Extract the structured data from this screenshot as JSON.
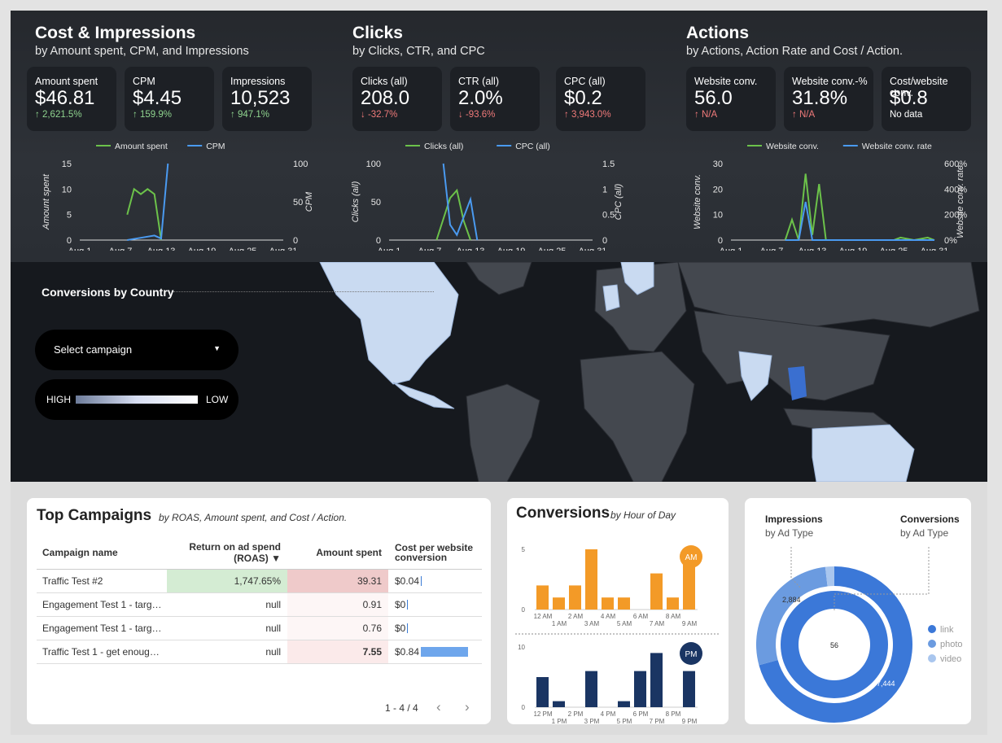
{
  "sections": [
    {
      "title": "Cost & Impressions",
      "subtitle": "by Amount spent, CPM, and Impressions",
      "cards": [
        {
          "label": "Amount spent",
          "value": "$46.81",
          "change": "2,621.5%",
          "dir": "up"
        },
        {
          "label": "CPM",
          "value": "$4.45",
          "change": "159.9%",
          "dir": "up"
        },
        {
          "label": "Impressions",
          "value": "10,523",
          "change": "947.1%",
          "dir": "up"
        }
      ]
    },
    {
      "title": "Clicks",
      "subtitle": "by Clicks, CTR, and CPC",
      "cards": [
        {
          "label": "Clicks (all)",
          "value": "208.0",
          "change": "-32.7%",
          "dir": "dn"
        },
        {
          "label": "CTR (all)",
          "value": "2.0%",
          "change": "-93.6%",
          "dir": "dn"
        },
        {
          "label": "CPC (all)",
          "value": "$0.2",
          "change": "3,943.0%",
          "dir": "dn"
        }
      ]
    },
    {
      "title": "Actions",
      "subtitle": "by Actions, Action Rate and Cost / Action.",
      "cards": [
        {
          "label": "Website conv.",
          "value": "56.0",
          "change": "N/A",
          "dir": "dn"
        },
        {
          "label": "Website conv.-%",
          "value": "31.8%",
          "change": "N/A",
          "dir": "dn"
        },
        {
          "label": "Cost/website conv.",
          "value": "$0.8",
          "change": "No data",
          "dir": "nd"
        }
      ]
    }
  ],
  "up_arrow": "↑",
  "down_arrow": "↓",
  "chart_data": [
    {
      "type": "line",
      "x": [
        "Aug 1",
        "Aug 7",
        "Aug 13",
        "Aug 19",
        "Aug 25",
        "Aug 31"
      ],
      "series": [
        {
          "name": "Amount spent",
          "axis": "left",
          "color": "#6cc24a",
          "points": [
            [
              8,
              5
            ],
            [
              9,
              10
            ],
            [
              10,
              9
            ],
            [
              11,
              10
            ],
            [
              12,
              9
            ],
            [
              13,
              0
            ]
          ]
        },
        {
          "name": "CPM",
          "axis": "right",
          "color": "#4a9af0",
          "points": [
            [
              8,
              0
            ],
            [
              10,
              3
            ],
            [
              12,
              6
            ],
            [
              13,
              2
            ],
            [
              14,
              100
            ]
          ]
        }
      ],
      "yleft": {
        "label": "Amount spent",
        "ticks": [
          "0",
          "5",
          "10",
          "15"
        ],
        "max": 15
      },
      "yright": {
        "label": "CPM",
        "ticks": [
          "0",
          "50",
          "100"
        ],
        "max": 100
      }
    },
    {
      "type": "line",
      "x": [
        "Aug 1",
        "Aug 7",
        "Aug 13",
        "Aug 19",
        "Aug 25",
        "Aug 31"
      ],
      "series": [
        {
          "name": "Clicks (all)",
          "axis": "left",
          "color": "#6cc24a",
          "points": [
            [
              8,
              0
            ],
            [
              10,
              55
            ],
            [
              11,
              65
            ],
            [
              12,
              25
            ],
            [
              13,
              0
            ]
          ]
        },
        {
          "name": "CPC (all)",
          "axis": "right",
          "color": "#4a9af0",
          "points": [
            [
              9,
              1.5
            ],
            [
              10,
              0.3
            ],
            [
              11,
              0.1
            ],
            [
              13,
              0.8
            ],
            [
              14,
              0
            ]
          ]
        }
      ],
      "yleft": {
        "label": "Clicks (all)",
        "ticks": [
          "0",
          "50",
          "100"
        ],
        "max": 100
      },
      "yright": {
        "label": "CPC (all)",
        "ticks": [
          "0",
          "0.5",
          "1",
          "1.5"
        ],
        "max": 1.5
      }
    },
    {
      "type": "line",
      "x": [
        "Aug 1",
        "Aug 7",
        "Aug 13",
        "Aug 19",
        "Aug 25",
        "Aug 31"
      ],
      "series": [
        {
          "name": "Website conv.",
          "axis": "left",
          "color": "#6cc24a",
          "points": [
            [
              9,
              0
            ],
            [
              10,
              8
            ],
            [
              11,
              0
            ],
            [
              12,
              26
            ],
            [
              13,
              2
            ],
            [
              14,
              22
            ],
            [
              15,
              0
            ],
            [
              25,
              0
            ],
            [
              26,
              1
            ],
            [
              28,
              0
            ],
            [
              30,
              1
            ],
            [
              31,
              0
            ]
          ]
        },
        {
          "name": "Website conv. rate",
          "axis": "right",
          "color": "#4a9af0",
          "points": [
            [
              9,
              0
            ],
            [
              11,
              0
            ],
            [
              12,
              300
            ],
            [
              13,
              0
            ],
            [
              31,
              0
            ]
          ]
        }
      ],
      "yleft": {
        "label": "Website conv.",
        "ticks": [
          "0",
          "10",
          "20",
          "30"
        ],
        "max": 30
      },
      "yright": {
        "label": "Website conv. rate",
        "ticks": [
          "0%",
          "200%",
          "400%",
          "600%"
        ],
        "max": 600
      }
    },
    {
      "type": "bar",
      "title": "AM",
      "categories": [
        "12 AM",
        "1 AM",
        "2 AM",
        "3 AM",
        "4 AM",
        "5 AM",
        "6 AM",
        "7 AM",
        "8 AM",
        "9 AM"
      ],
      "values": [
        2,
        1,
        2,
        5,
        1,
        1,
        0,
        3,
        1,
        5
      ],
      "ticks": [
        "0",
        "5"
      ],
      "max": 5,
      "color": "#f39a27"
    },
    {
      "type": "bar",
      "title": "PM",
      "categories": [
        "12 PM",
        "1 PM",
        "2 PM",
        "3 PM",
        "4 PM",
        "5 PM",
        "6 PM",
        "7 PM",
        "8 PM",
        "9 PM"
      ],
      "values": [
        5,
        1,
        0,
        6,
        0,
        1,
        6,
        9,
        0,
        6
      ],
      "ticks": [
        "0",
        "10"
      ],
      "max": 10,
      "color": "#1a3563"
    },
    {
      "type": "pie",
      "title": "Impressions by Ad Type / Conversions by Ad Type",
      "impressions": [
        {
          "label": "link",
          "value": 7444
        },
        {
          "label": "photo",
          "value": 2884
        },
        {
          "label": "video",
          "value": 195
        }
      ],
      "conversions": [
        {
          "label": "link",
          "value": 56
        }
      ]
    }
  ],
  "map": {
    "title": "Conversions by Country",
    "select_label": "Select campaign",
    "legend_high": "HIGH",
    "legend_low": "LOW"
  },
  "campaigns": {
    "title": "Top Campaigns",
    "subtitle": "by ROAS, Amount spent, and Cost / Action.",
    "headers": [
      "Campaign name",
      "Return on ad spend (ROAS) ▼",
      "Amount spent",
      "Cost per website conversion"
    ],
    "rows": [
      {
        "name": "Traffic Test #2",
        "roas": "1,747.65%",
        "spent": "39.31",
        "cost": "$0.04",
        "cost_frac": 0.02
      },
      {
        "name": "Engagement Test 1 - targ…",
        "roas": "null",
        "spent": "0.91",
        "cost": "$0",
        "cost_frac": 0
      },
      {
        "name": "Engagement Test 1 - targ…",
        "roas": "null",
        "spent": "0.76",
        "cost": "$0",
        "cost_frac": 0
      },
      {
        "name": "Traffic Test 1 - get enoug…",
        "roas": "null",
        "spent": "7.55",
        "cost": "$0.84",
        "cost_frac": 1
      }
    ],
    "pager": "1 - 4 / 4",
    "prev": "‹",
    "next": "›"
  },
  "conversions": {
    "title": "Conversions",
    "subtitle": "by Hour of Day"
  },
  "adtype": {
    "impressions_title": "Impressions",
    "impressions_sub": "by Ad Type",
    "conversions_title": "Conversions",
    "conversions_sub": "by Ad Type",
    "label_outer_small": "2,884",
    "label_outer_big": "7,444",
    "label_inner": "56",
    "legend": [
      {
        "name": "link",
        "color": "#3b78d8"
      },
      {
        "name": "photo",
        "color": "#6b9be0"
      },
      {
        "name": "video",
        "color": "#a9c6ee"
      }
    ]
  }
}
